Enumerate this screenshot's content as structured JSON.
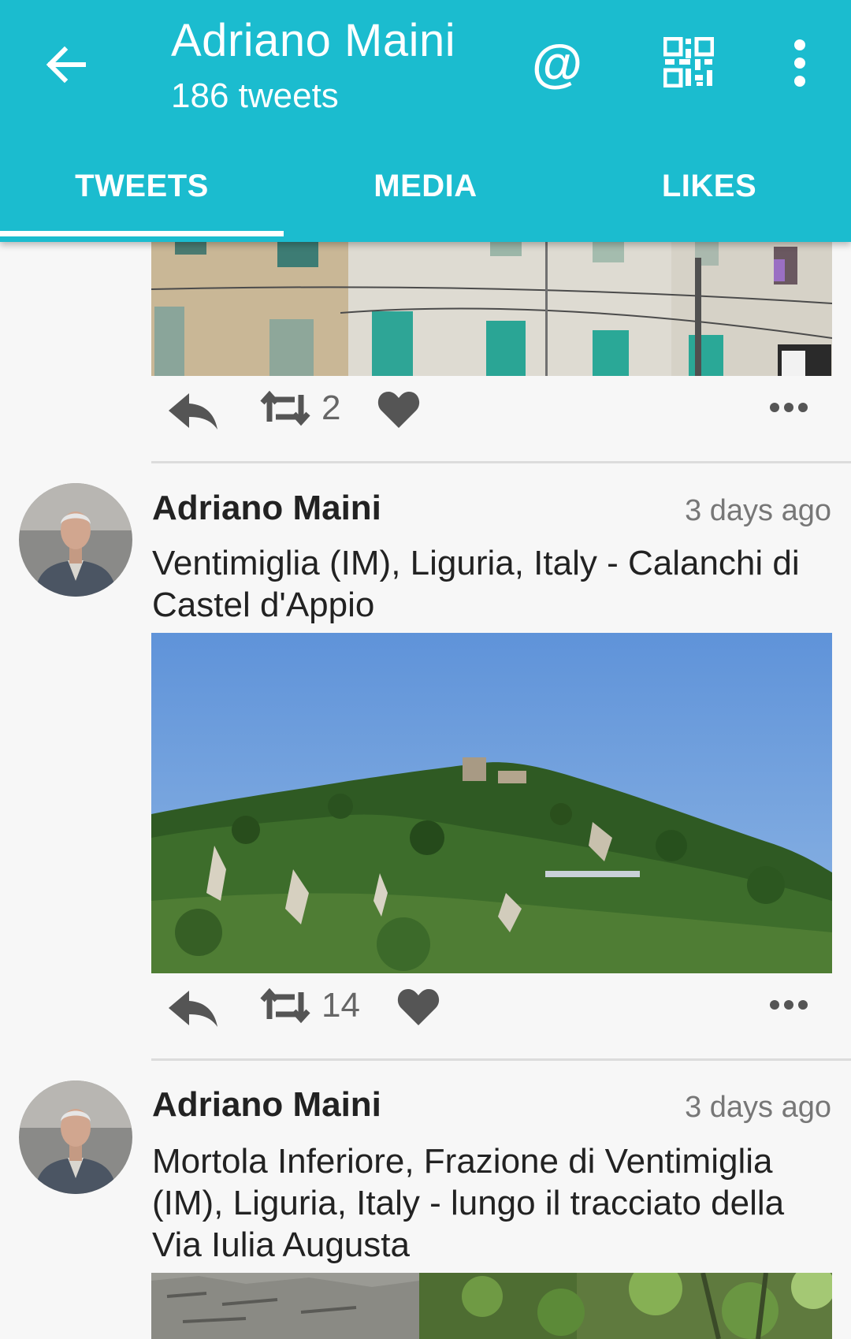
{
  "header": {
    "title": "Adriano Maini",
    "subtitle": "186 tweets",
    "accent_color": "#1bbccf",
    "icons": [
      "arrow-left-icon",
      "at-icon",
      "qr-code-icon",
      "more-vert-icon"
    ]
  },
  "tabs": [
    {
      "label": "TWEETS",
      "selected": true
    },
    {
      "label": "MEDIA",
      "selected": false
    },
    {
      "label": "LIKES",
      "selected": false
    }
  ],
  "tweets": [
    {
      "retweets": "2",
      "icons": [
        "reply-icon",
        "retweet-icon",
        "heart-icon",
        "more-horiz-icon"
      ]
    },
    {
      "author": "Adriano Maini",
      "time": "3 days ago",
      "text": "Ventimiglia (IM), Liguria, Italy - Calanchi di Castel d'Appio",
      "retweets": "14"
    },
    {
      "author": "Adriano Maini",
      "time": "3 days ago",
      "text": "Mortola Inferiore, Frazione di Ventimiglia (IM), Liguria, Italy - lungo il tracciato della Via Iulia Augusta"
    }
  ]
}
